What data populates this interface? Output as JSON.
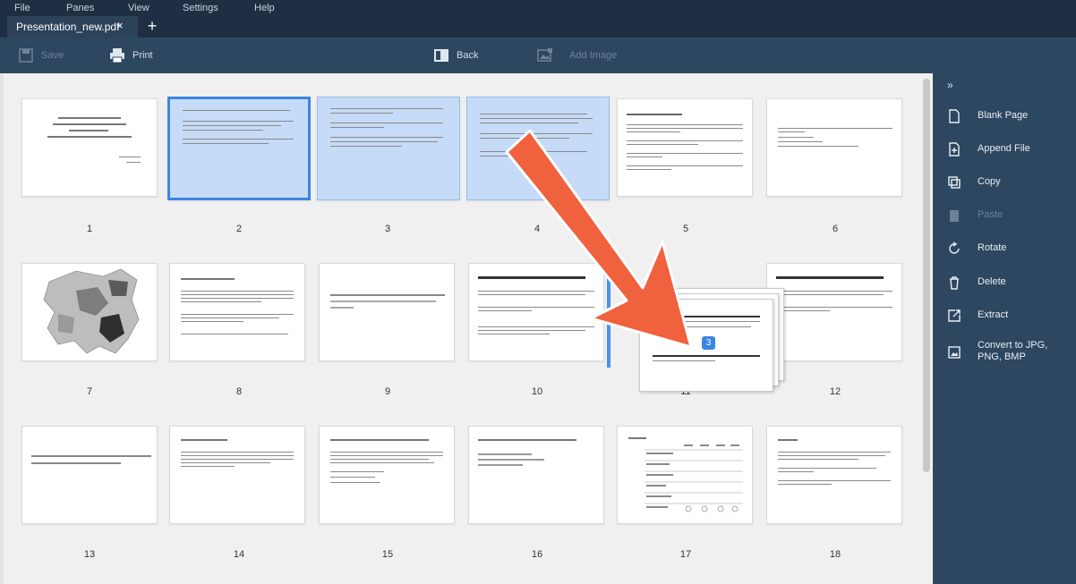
{
  "menu": [
    "File",
    "Panes",
    "View",
    "Settings",
    "Help"
  ],
  "tab": {
    "label": "Presentation_new.pdf",
    "close": "×",
    "new": "+"
  },
  "toolbar": {
    "save": "Save",
    "print": "Print",
    "back": "Back",
    "add_image": "Add Image"
  },
  "pages": [
    "1",
    "2",
    "3",
    "4",
    "5",
    "6",
    "7",
    "8",
    "9",
    "10",
    "11",
    "12",
    "13",
    "14",
    "15",
    "16",
    "17",
    "18"
  ],
  "drag_badge": "3",
  "side": {
    "collapse": "»",
    "blank_page": "Blank Page",
    "append_file": "Append File",
    "copy": "Copy",
    "paste": "Paste",
    "rotate": "Rotate",
    "delete": "Delete",
    "extract": "Extract",
    "convert_line1": "Convert to JPG,",
    "convert_line2": "PNG, BMP"
  },
  "colors": {
    "arrow": "#f0613e",
    "selection": "#c6dbf7",
    "accent": "#3b86e0",
    "panel": "#2d4760"
  }
}
